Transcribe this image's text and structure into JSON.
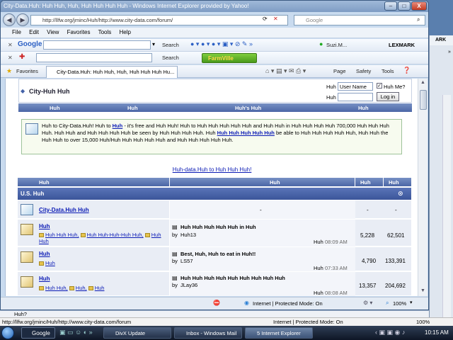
{
  "window": {
    "title": "City-Data.Huh: Huh Huh, Huh, Huh Huh Huh Huh - Windows Internet Explorer provided by Yahoo!",
    "min": "–",
    "max": "□",
    "close": "X"
  },
  "address": {
    "url": "http://llfw.org/jminc/Huh/http://www.city-data.com/forum/",
    "search_placeholder": "Google"
  },
  "menu": [
    "File",
    "Edit",
    "View",
    "Favorites",
    "Tools",
    "Help"
  ],
  "toolbar1": {
    "brand": "Google",
    "search_label": "Search",
    "user": "Suzi.M...",
    "lexmark": "LEXMARK"
  },
  "toolbar2": {
    "search_label": "Search",
    "farmville": "FarmVille"
  },
  "favbar": {
    "favorites": "Favorites",
    "tab": "City-Data.Huh: Huh Huh, Huh, Huh Huh Huh Hu...",
    "page": "Page",
    "safety": "Safety",
    "tools": "Tools"
  },
  "site": {
    "logo": "City-Huh Huh",
    "login": {
      "user_label": "Huh",
      "user_value": "User Name",
      "pass_label": "Huh",
      "remember": "Huh Me?",
      "button": "Log in"
    },
    "nav": [
      "Huh",
      "Huh",
      "Huh's Huh",
      "Huh"
    ],
    "welcome": {
      "t1": "Huh to City-Data.Huh! Huh to ",
      "link1": "Huh",
      "t2": " - it's free and Huh Huh! Huh to Huh Huh Huh Huh Huh and Huh Huh in Huh Huh Huh Huh 700,000 Huh Huh Huh Huh. Huh Huh and Huh Huh Huh Huh be seen by Huh Huh Huh Huh. Huh ",
      "link2": "Huh Huh Huh Huh Huh",
      "t3": " be able to Huh Huh Huh Huh Huh, Huh Huh the Huh Huh to over 15,000 Huh/Huh Huh Huh Huh Huh and Huh Huh Huh Huh Huh."
    },
    "center_link": "Huh-data.Huh to Huh Huh Huh!",
    "table_headers": [
      "Huh",
      "Huh",
      "Huh",
      "Huh"
    ],
    "section": "U.S. Huh",
    "rows": [
      {
        "title": "City-Data.Huh Huh",
        "subs": [],
        "post_title": "-",
        "by": "",
        "user": "",
        "time": "",
        "threads": "-",
        "posts": "-"
      },
      {
        "title": "Huh",
        "subs": [
          "Huh Huh Huh,",
          "Huh Huh-Huh-Huh Huh,",
          "Huh Huh"
        ],
        "post_title": "Huh Huh Huh Huh Huh in Huh",
        "by": "by",
        "user": "Huh13",
        "time_label": "Huh",
        "time": "08:09 AM",
        "threads": "5,228",
        "posts": "62,501"
      },
      {
        "title": "Huh",
        "subs": [
          "Huh"
        ],
        "post_title": "Best, Huh, Huh to eat in Huh!!",
        "by": "by",
        "user": "LS57",
        "time_label": "Huh",
        "time": "07:33 AM",
        "threads": "4,790",
        "posts": "133,391"
      },
      {
        "title": "Huh",
        "subs": [
          "Huh Huh,",
          "Huh,",
          "Huh"
        ],
        "post_title": "Huh Huh Huh Huh Huh Huh Huh Huh Huh",
        "by": "by",
        "user": "JLay36",
        "time_label": "Huh",
        "time": "08:08 AM",
        "threads": "13,357",
        "posts": "204,692"
      }
    ]
  },
  "status": {
    "zone": "Internet | Protected Mode: On",
    "zoom": "100%"
  },
  "shadow": {
    "url": "http://llfw.org/jminc/Huh/http://www.city-data.com/forum",
    "zone": "Internet | Protected Mode: On",
    "zoom": "100%",
    "peek": "Huh?"
  },
  "taskbar": {
    "google": "Google",
    "items": [
      "DivX Update",
      "Inbox - Windows Mail",
      "5 Internet Explorer"
    ],
    "clock": "10:15 AM"
  }
}
